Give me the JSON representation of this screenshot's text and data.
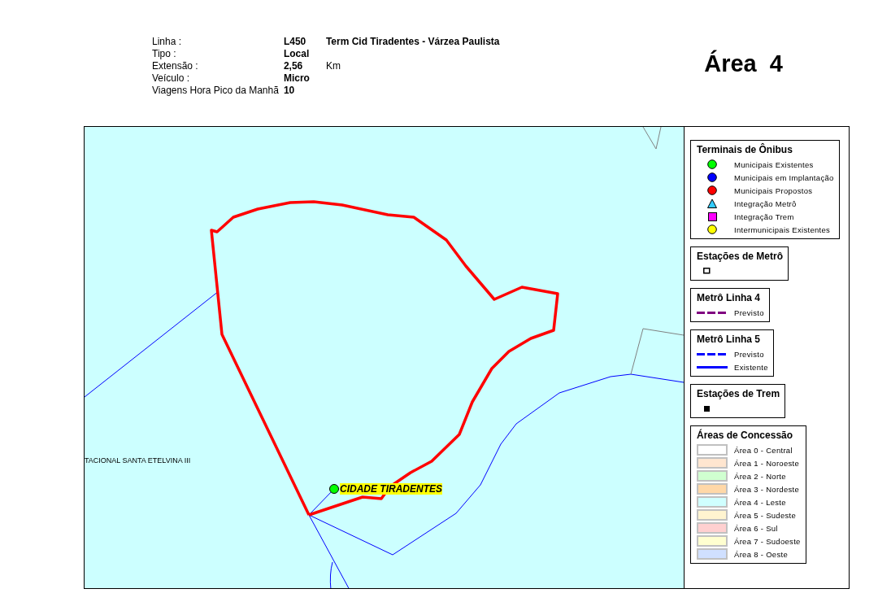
{
  "header": {
    "fields": [
      {
        "label": "Linha :",
        "value": "L450",
        "extra": "Term Cid Tiradentes - Várzea Paulista",
        "extra_bold": true
      },
      {
        "label": "Tipo :",
        "value": "Local"
      },
      {
        "label": "Extensão :",
        "value": "2,56",
        "extra": "Km",
        "extra_bold": false
      },
      {
        "label": "Veículo :",
        "value": "Micro"
      },
      {
        "label": "Viagens Hora Pico da Manhã",
        "value": "10"
      }
    ],
    "area_title": "Área  4"
  },
  "map": {
    "edge_label": "TACIONAL SANTA ETELVINA III",
    "terminals": [
      {
        "name": "CIDADE TIRADENTES",
        "color": "#00ff00"
      }
    ]
  },
  "legend": [
    {
      "title": "Terminais de Ônibus",
      "items": [
        {
          "kind": "circle",
          "color": "#00ff00",
          "label": "Municipais Existentes"
        },
        {
          "kind": "circle",
          "color": "#0000ff",
          "label": "Municipais em Implantação"
        },
        {
          "kind": "circle",
          "color": "#ff0000",
          "label": "Municipais Propostos"
        },
        {
          "kind": "triangle",
          "color": "#33ccff",
          "label": "Integração Metrô"
        },
        {
          "kind": "square",
          "color": "#ff00ff",
          "label": "Integração Trem"
        },
        {
          "kind": "circle",
          "color": "#ffff00",
          "label": "Intermunicipais Existentes"
        }
      ]
    },
    {
      "title": "Estações de Metrô",
      "items": [
        {
          "kind": "hollow-square",
          "color": "#000000"
        }
      ]
    },
    {
      "title": "Metrô Linha 4",
      "items": [
        {
          "kind": "dashed",
          "color": "#800080",
          "label": "Previsto"
        }
      ]
    },
    {
      "title": "Metrô Linha 5",
      "items": [
        {
          "kind": "dashed",
          "color": "#0000ff",
          "label": "Previsto"
        },
        {
          "kind": "solid",
          "color": "#0000ff",
          "label": "Existente"
        }
      ]
    },
    {
      "title": "Estações de Trem",
      "items": [
        {
          "kind": "small-square",
          "color": "#000000"
        }
      ]
    },
    {
      "title": "Áreas de Concessão",
      "items": [
        {
          "kind": "swatch",
          "color": "#ffffff",
          "label": "Área 0 - Central"
        },
        {
          "kind": "swatch",
          "color": "#ffe6d0",
          "label": "Área 1 - Noroeste"
        },
        {
          "kind": "swatch",
          "color": "#d0ffd0",
          "label": "Área 2 - Norte"
        },
        {
          "kind": "swatch",
          "color": "#ffd8a8",
          "label": "Área 3 - Nordeste"
        },
        {
          "kind": "swatch",
          "color": "#d0ffff",
          "label": "Área 4 - Leste"
        },
        {
          "kind": "swatch",
          "color": "#fff4d0",
          "label": "Área 5 - Sudeste"
        },
        {
          "kind": "swatch",
          "color": "#ffd0d0",
          "label": "Área 6 - Sul"
        },
        {
          "kind": "swatch",
          "color": "#ffffd0",
          "label": "Área 7 - Sudoeste"
        },
        {
          "kind": "swatch",
          "color": "#d0e0ff",
          "label": "Área 8 - Oeste"
        }
      ]
    }
  ]
}
